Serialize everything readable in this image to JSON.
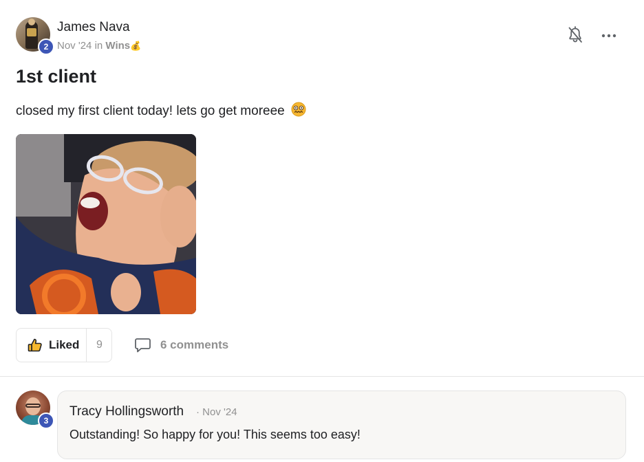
{
  "post": {
    "author": {
      "name": "James Nava",
      "level": "2",
      "avatar_icon": "user-photo"
    },
    "meta": {
      "date": "Nov '24",
      "in_word": "in",
      "category": "Wins",
      "category_icon": "💰"
    },
    "title": "1st client",
    "body": "closed my first client today! lets go get moreee",
    "body_emoji": "woozy-face",
    "image_alt": "animated gif of a cheering child",
    "actions": {
      "like_label": "Liked",
      "like_count": "9",
      "comments_label": "6 comments"
    },
    "header_icons": [
      "bell-off-icon",
      "more-options-icon"
    ]
  },
  "comment": {
    "author": "Tracy Hollingsworth",
    "level": "3",
    "separator": "·",
    "date": "Nov '24",
    "text": "Outstanding! So happy for you! This seems too easy!"
  },
  "colors": {
    "badge": "#3d56b6",
    "muted": "#909090",
    "text": "#202124",
    "border": "#e4e4e4",
    "comment_bg": "#f8f7f5",
    "like_icon": "#f5b82e"
  }
}
